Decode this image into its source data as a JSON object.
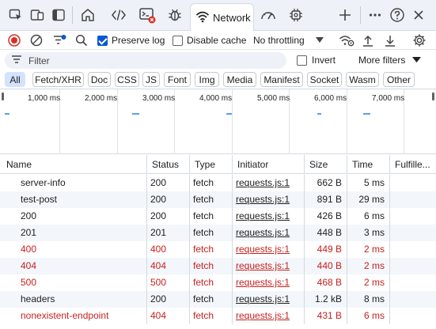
{
  "tabbar": {
    "active_tab": "Network"
  },
  "toolbar": {
    "preserve_log_label": "Preserve log",
    "preserve_log_checked": true,
    "disable_cache_label": "Disable cache",
    "disable_cache_checked": false,
    "throttling_value": "No throttling"
  },
  "filter": {
    "placeholder": "Filter",
    "invert_label": "Invert",
    "more_filters_label": "More filters"
  },
  "type_chips": [
    "All",
    "Fetch/XHR",
    "Doc",
    "CSS",
    "JS",
    "Font",
    "Img",
    "Media",
    "Manifest",
    "Socket",
    "Wasm",
    "Other"
  ],
  "timeline": {
    "ticks": [
      "1,000 ms",
      "2,000 ms",
      "3,000 ms",
      "4,000 ms",
      "5,000 ms",
      "6,000 ms",
      "7,000 ms"
    ]
  },
  "table": {
    "columns": [
      "Name",
      "Status",
      "Type",
      "Initiator",
      "Size",
      "Time",
      "Fulfille..."
    ],
    "rows": [
      {
        "name": "server-info",
        "status": "200",
        "type": "fetch",
        "initiator": "requests.js:1",
        "size": "662 B",
        "time": "5 ms",
        "error": false
      },
      {
        "name": "test-post",
        "status": "200",
        "type": "fetch",
        "initiator": "requests.js:1",
        "size": "891 B",
        "time": "29 ms",
        "error": false
      },
      {
        "name": "200",
        "status": "200",
        "type": "fetch",
        "initiator": "requests.js:1",
        "size": "426 B",
        "time": "6 ms",
        "error": false
      },
      {
        "name": "201",
        "status": "201",
        "type": "fetch",
        "initiator": "requests.js:1",
        "size": "448 B",
        "time": "3 ms",
        "error": false
      },
      {
        "name": "400",
        "status": "400",
        "type": "fetch",
        "initiator": "requests.js:1",
        "size": "449 B",
        "time": "2 ms",
        "error": true
      },
      {
        "name": "404",
        "status": "404",
        "type": "fetch",
        "initiator": "requests.js:1",
        "size": "440 B",
        "time": "2 ms",
        "error": true
      },
      {
        "name": "500",
        "status": "500",
        "type": "fetch",
        "initiator": "requests.js:1",
        "size": "468 B",
        "time": "2 ms",
        "error": true
      },
      {
        "name": "headers",
        "status": "200",
        "type": "fetch",
        "initiator": "requests.js:1",
        "size": "1.2 kB",
        "time": "8 ms",
        "error": false
      },
      {
        "name": "nonexistent-endpoint",
        "status": "404",
        "type": "fetch",
        "initiator": "requests.js:1",
        "size": "431 B",
        "time": "6 ms",
        "error": true
      }
    ]
  },
  "colors": {
    "accent": "#0b57d0",
    "error_text": "#c5221f",
    "record_red": "#d93025",
    "timeline_bar": "#5f9df2"
  }
}
